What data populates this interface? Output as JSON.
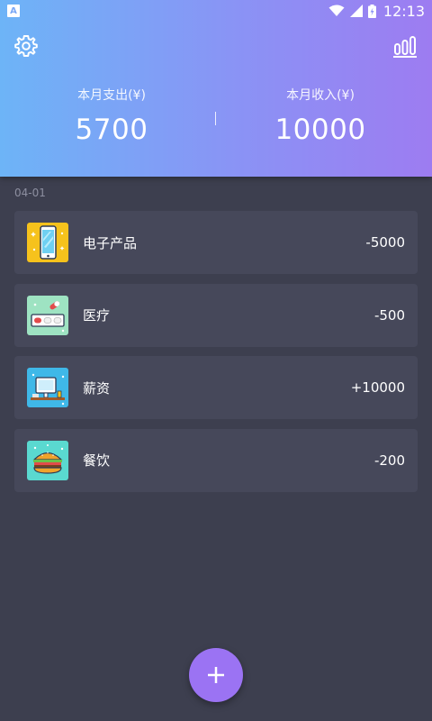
{
  "status_bar": {
    "time": "12:13",
    "icons": [
      "app-notification-icon",
      "wifi-icon",
      "cell-signal-icon",
      "battery-charging-icon"
    ]
  },
  "header": {
    "settings_icon": "gear-icon",
    "stats_icon": "bar-chart-icon",
    "expense_label": "本月支出(¥)",
    "expense_value": "5700",
    "income_label": "本月收入(¥)",
    "income_value": "10000"
  },
  "list": {
    "date": "04-01",
    "items": [
      {
        "name": "电子产品",
        "amount": "-5000",
        "icon": "electronics-icon"
      },
      {
        "name": "医疗",
        "amount": "-500",
        "icon": "medical-icon"
      },
      {
        "name": "薪资",
        "amount": "+10000",
        "icon": "salary-icon"
      },
      {
        "name": "餐饮",
        "amount": "-200",
        "icon": "food-icon"
      }
    ]
  },
  "fab": {
    "icon": "plus-icon"
  },
  "colors": {
    "background": "#3d3f4f",
    "card": "#46485a",
    "header_start": "#6db4f7",
    "header_end": "#9d7cf1",
    "fab": "#9b73f3"
  }
}
